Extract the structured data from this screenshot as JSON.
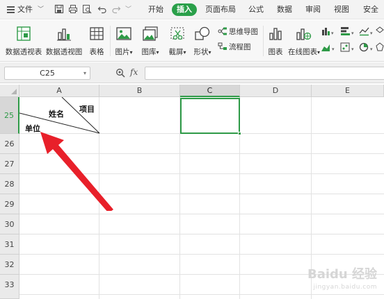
{
  "menubar": {
    "file_label": "文件",
    "tabs": [
      {
        "label": "开始",
        "active": false
      },
      {
        "label": "插入",
        "active": true
      },
      {
        "label": "页面布局",
        "active": false
      },
      {
        "label": "公式",
        "active": false
      },
      {
        "label": "数据",
        "active": false
      },
      {
        "label": "审阅",
        "active": false
      },
      {
        "label": "视图",
        "active": false
      },
      {
        "label": "安全",
        "active": false
      }
    ]
  },
  "ribbon": {
    "pivot_table": "数据透视表",
    "pivot_chart": "数据透视图",
    "table": "表格",
    "picture": "图片",
    "gallery": "图库",
    "screenshot": "截屏",
    "shape": "形状",
    "mind_map": "思维导图",
    "flowchart": "流程图",
    "chart": "图表",
    "online_chart": "在线图表"
  },
  "formula_bar": {
    "name_box": "C25",
    "fx_label": "fx",
    "formula": ""
  },
  "grid": {
    "columns": [
      "A",
      "B",
      "C",
      "D",
      "E"
    ],
    "selected_column": "C",
    "rows": [
      "25",
      "26",
      "27",
      "28",
      "29",
      "30",
      "31",
      "32",
      "33"
    ],
    "selected_row": "25",
    "cell_a25": {
      "top_right": "项目",
      "middle": "姓名",
      "bottom_left": "单位"
    }
  },
  "watermark": {
    "main": "Baidu 经验",
    "sub": "jingyan.baidu.com"
  },
  "colors": {
    "accent_green": "#2e9a47",
    "arrow_red": "#e8202a"
  }
}
